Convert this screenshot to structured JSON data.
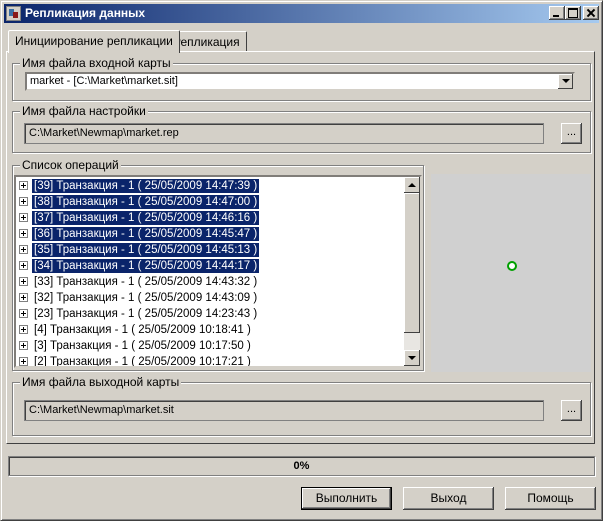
{
  "window": {
    "title": "Репликация данных"
  },
  "tabs": [
    {
      "label": "Инициирование репликации",
      "active": true
    },
    {
      "label": "Репликация",
      "active": false
    }
  ],
  "input_map": {
    "label": "Имя файла входной карты",
    "selected": "market - [C:\\Market\\market.sit]"
  },
  "settings_file": {
    "label": "Имя файла настройки",
    "value": "C:\\Market\\Newmap\\market.rep",
    "browse_label": "..."
  },
  "operations": {
    "label": "Список операций",
    "items": [
      {
        "text": "[39] Транзакция - 1 ( 25/05/2009  14:47:39 )",
        "selected": true
      },
      {
        "text": "[38] Транзакция - 1 ( 25/05/2009  14:47:00 )",
        "selected": true
      },
      {
        "text": "[37] Транзакция - 1 ( 25/05/2009  14:46:16 )",
        "selected": true
      },
      {
        "text": "[36] Транзакция - 1 ( 25/05/2009  14:45:47 )",
        "selected": true
      },
      {
        "text": "[35] Транзакция - 1 ( 25/05/2009  14:45:13 )",
        "selected": true
      },
      {
        "text": "[34] Транзакция - 1 ( 25/05/2009  14:44:17 )",
        "selected": true
      },
      {
        "text": "[33] Транзакция - 1 ( 25/05/2009  14:43:32 )",
        "selected": false
      },
      {
        "text": "[32] Транзакция - 1 ( 25/05/2009  14:43:09 )",
        "selected": false
      },
      {
        "text": "[23] Транзакция - 1 ( 25/05/2009  14:23:43 )",
        "selected": false
      },
      {
        "text": "[4] Транзакция - 1 ( 25/05/2009  10:18:41 )",
        "selected": false
      },
      {
        "text": "[3] Транзакция - 1 ( 25/05/2009  10:17:50 )",
        "selected": false
      },
      {
        "text": "[2] Транзакция - 1 ( 25/05/2009  10:17:21 )",
        "selected": false
      }
    ]
  },
  "output_map": {
    "label": "Имя файла выходной карты",
    "value": "C:\\Market\\Newmap\\market.sit",
    "browse_label": "..."
  },
  "progress": {
    "text": "0%",
    "fraction": 0
  },
  "buttons": {
    "run": "Выполнить",
    "exit": "Выход",
    "help": "Помощь"
  },
  "colors": {
    "selection": "#0a246a",
    "map_point": "#00a000"
  }
}
